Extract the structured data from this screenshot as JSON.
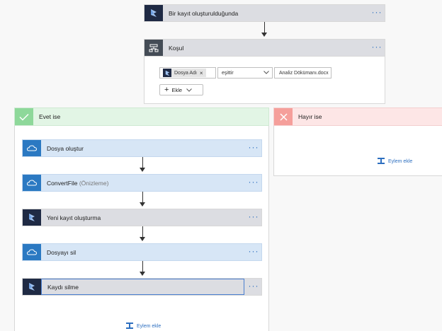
{
  "trigger": {
    "title": "Bir kayıt oluşturulduğunda",
    "icon": "dynamics-icon",
    "more": "···"
  },
  "condition": {
    "title": "Koşul",
    "icon": "condition-icon",
    "more": "···",
    "token_label": "Dosya Adı",
    "token_remove": "×",
    "operator": "eşittir",
    "value": "Analiz Dökümanı.docx",
    "add_label": "Ekle"
  },
  "yes_branch": {
    "title": "Evet ise",
    "steps": [
      {
        "title": "Dosya oluştur",
        "preview": "",
        "icon": "onedrive-icon",
        "more": "···"
      },
      {
        "title": "ConvertFile",
        "preview": "(Önizleme)",
        "icon": "onedrive-icon",
        "more": "···"
      },
      {
        "title": "Yeni kayıt oluşturma",
        "preview": "",
        "icon": "dynamics-icon",
        "more": "···"
      },
      {
        "title": "Dosyayı sil",
        "preview": "",
        "icon": "onedrive-icon",
        "more": "···"
      },
      {
        "title": "Kaydı silme",
        "preview": "",
        "icon": "dynamics-icon",
        "more": "···"
      }
    ],
    "add_action": "Eylem ekle"
  },
  "no_branch": {
    "title": "Hayır ise",
    "add_action": "Eylem ekle"
  },
  "colors": {
    "dynamics_bg": "#1f2a44",
    "onedrive_bg": "#2b79c2",
    "onedrive_card": "#d7e6f6",
    "dynamics_card": "#dcdde2",
    "yes_header": "#e2f5e5",
    "no_header": "#fde6e6",
    "link": "#2d6fc0"
  }
}
